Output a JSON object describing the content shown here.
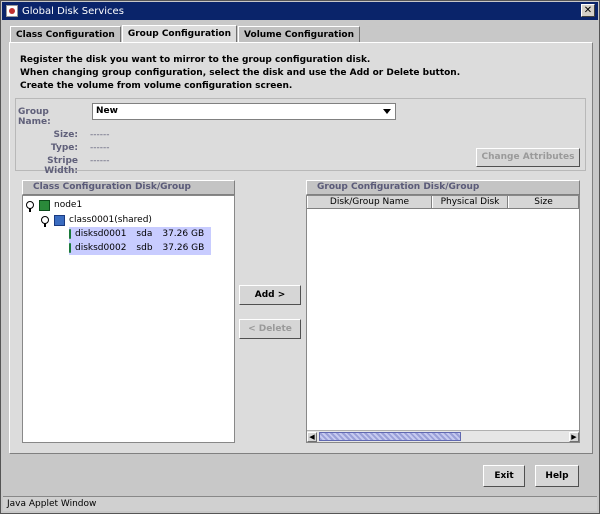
{
  "window": {
    "title": "Global Disk Services",
    "close_label": "✕"
  },
  "tabs": [
    {
      "label": "Class Configuration",
      "active": false
    },
    {
      "label": "Group Configuration",
      "active": true
    },
    {
      "label": "Volume Configuration",
      "active": false
    }
  ],
  "instructions": [
    "Register the disk you want to mirror to the group configuration disk.",
    "When changing group configuration, select the disk and use the Add or Delete button.",
    "Create the volume from volume configuration screen."
  ],
  "group_form": {
    "group_name_label": "Group Name:",
    "group_name_value": "New",
    "size_label": "Size:",
    "size_value": "------",
    "type_label": "Type:",
    "type_value": "------",
    "stripe_width_label": "Stripe Width:",
    "stripe_width_value": "------",
    "change_attributes_label": "Change Attributes"
  },
  "class_panel": {
    "header": "Class Configuration Disk/Group",
    "tree": {
      "node": "node1",
      "class": "class0001(shared)",
      "disks": [
        {
          "name": "disksd0001",
          "physical": "sda",
          "size": "37.26 GB"
        },
        {
          "name": "disksd0002",
          "physical": "sdb",
          "size": "37.26 GB"
        }
      ]
    }
  },
  "buttons": {
    "add": "Add >",
    "delete": "< Delete",
    "exit": "Exit",
    "help": "Help"
  },
  "group_panel": {
    "header": "Group Configuration Disk/Group",
    "columns": [
      "Disk/Group Name",
      "Physical Disk",
      "Size"
    ]
  },
  "status_bar": "Java Applet Window",
  "colors": {
    "title_bar": "#0a246a",
    "panel_header_text": "#5a5a78",
    "selection": "#c8ccff"
  }
}
